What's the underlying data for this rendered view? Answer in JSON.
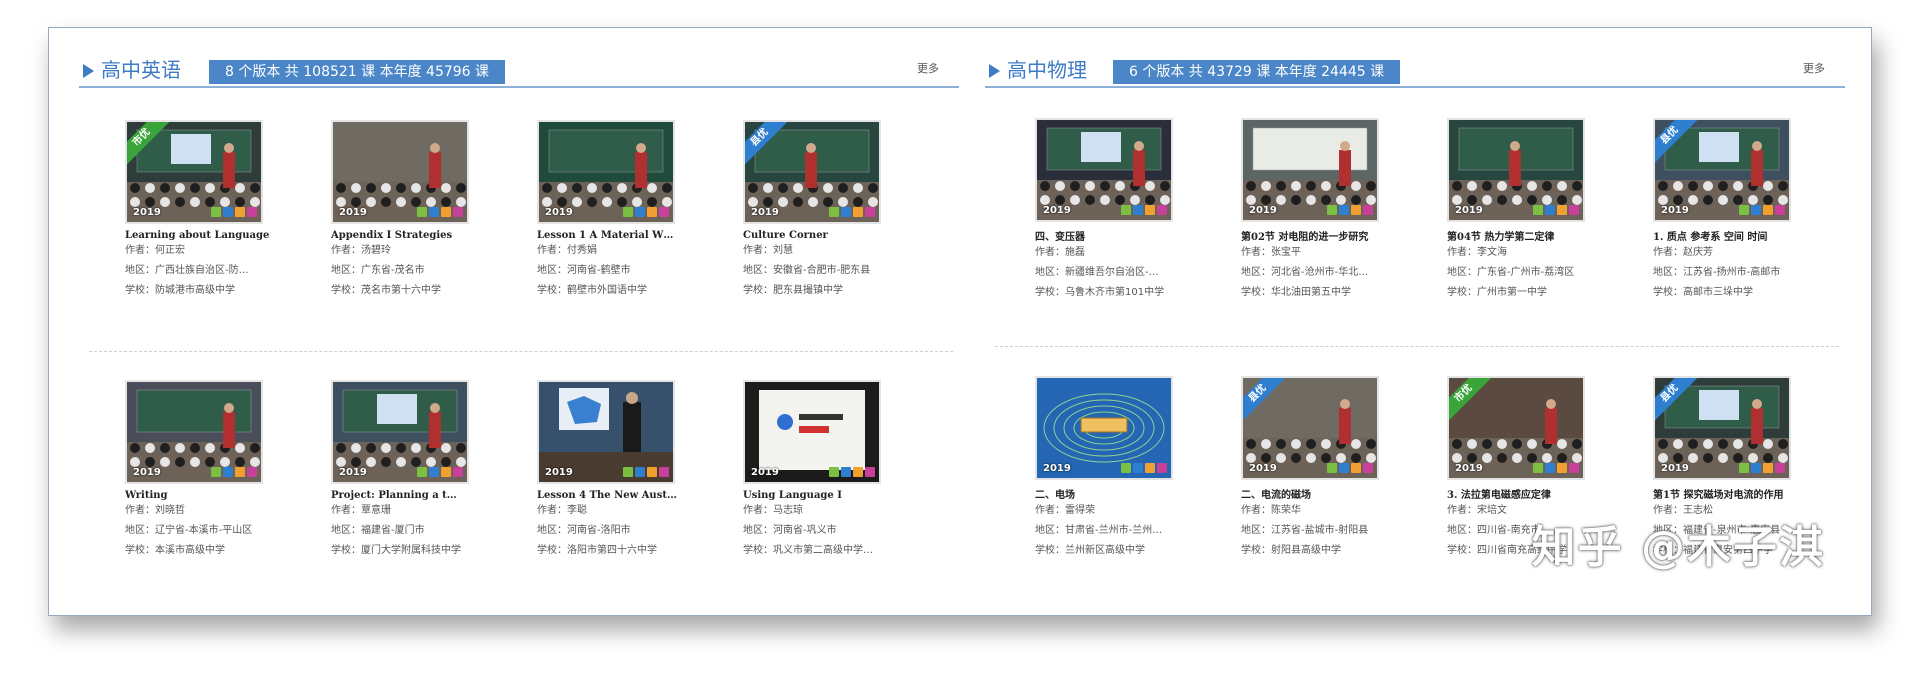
{
  "left": {
    "title": "高中英语",
    "stats": "8 个版本  共 108521 课  本年度 45796 课",
    "more": "更多",
    "cards": [
      {
        "title": "Learning about Language",
        "author": "何正宏",
        "region": "广西壮族自治区-防…",
        "school": "防城港市高级中学",
        "year": "2019",
        "badge": "市优",
        "scene": "classroom-board"
      },
      {
        "title": "Appendix I Strategies",
        "author": "汤碧玲",
        "region": "广东省-茂名市",
        "school": "茂名市第十六中学",
        "year": "2019",
        "badge": "",
        "scene": "classroom-students"
      },
      {
        "title": "Lesson 1 A Material W…",
        "author": "付秀娟",
        "region": "河南省-鹤壁市",
        "school": "鹤壁市外国语中学",
        "year": "2019",
        "badge": "",
        "scene": "chalkboard"
      },
      {
        "title": "Culture Corner",
        "author": "刘慧",
        "region": "安徽省-合肥市-肥东县",
        "school": "肥东县撮镇中学",
        "year": "2019",
        "badge": "县优",
        "scene": "teacher-board"
      },
      {
        "title": "Writing",
        "author": "刘晓哲",
        "region": "辽宁省-本溪市-平山区",
        "school": "本溪市高级中学",
        "year": "2019",
        "badge": "",
        "scene": "auditorium"
      },
      {
        "title": "Project: Planning a t…",
        "author": "覃意珊",
        "region": "福建省-厦门市",
        "school": "厦门大学附属科技中学",
        "year": "2019",
        "badge": "",
        "scene": "classroom-screen"
      },
      {
        "title": "Lesson 4 The New Aust…",
        "author": "李聪",
        "region": "河南省-洛阳市",
        "school": "洛阳市第四十六中学",
        "year": "2019",
        "badge": "",
        "scene": "map-slide"
      },
      {
        "title": "Using Language Ⅰ",
        "author": "马志琼",
        "region": "河南省-巩义市",
        "school": "巩义市第二高级中学…",
        "year": "2019",
        "badge": "",
        "scene": "slide-text",
        "slide_text": "阅读理解常考的4大题型"
      }
    ]
  },
  "right": {
    "title": "高中物理",
    "stats": "6 个版本  共 43729 课  本年度 24445 课",
    "more": "更多",
    "cards": [
      {
        "title": "四、变压器",
        "author": "施磊",
        "region": "新疆维吾尔自治区-…",
        "school": "乌鲁木齐市第101中学",
        "year": "2019",
        "badge": "",
        "scene": "projector"
      },
      {
        "title": "第02节 对电阻的进一步研究",
        "author": "张宝平",
        "region": "河北省-沧州市-华北…",
        "school": "华北油田第五中学",
        "year": "2019",
        "badge": "",
        "scene": "whiteboard"
      },
      {
        "title": "第04节 热力学第二定律",
        "author": "李文海",
        "region": "广东省-广州市-荔湾区",
        "school": "广州市第一中学",
        "year": "2019",
        "badge": "",
        "scene": "teacher-board"
      },
      {
        "title": "1. 质点 参考系 空间 时间",
        "author": "赵庆芳",
        "region": "江苏省-扬州市-高邮市",
        "school": "高邮市三垛中学",
        "year": "2019",
        "badge": "县优",
        "scene": "classroom-screen"
      },
      {
        "title": "二、电场",
        "author": "雷得荣",
        "region": "甘肃省-兰州市-兰州…",
        "school": "兰州新区高级中学",
        "year": "2019",
        "badge": "",
        "scene": "field-diagram"
      },
      {
        "title": "二、电流的磁场",
        "author": "陈荣华",
        "region": "江苏省-盐城市-射阳县",
        "school": "射阳县高级中学",
        "year": "2019",
        "badge": "县优",
        "scene": "classroom-students"
      },
      {
        "title": "3. 法拉第电磁感应定律",
        "author": "宋培文",
        "region": "四川省-南充市",
        "school": "四川省南充高级中学",
        "year": "2019",
        "badge": "市优",
        "scene": "lab"
      },
      {
        "title": "第1节 探究磁场对电流的作用",
        "author": "王志松",
        "region": "福建省-泉州市-惠安县",
        "school": "福建省惠安第四中学",
        "year": "2019",
        "badge": "县优",
        "scene": "classroom-board"
      }
    ]
  },
  "labels": {
    "author": "作者：",
    "region": "地区：",
    "school": "学校："
  },
  "watermark": "知乎 @木子淇",
  "colors": {
    "accent": "#3d7bc4",
    "stats_bg": "#4a86c8",
    "badge_city": "#3aa33a",
    "badge_county": "#2f7fd0",
    "chips": [
      "#7bc043",
      "#2f7fd0",
      "#f0a030",
      "#c8409a"
    ]
  }
}
